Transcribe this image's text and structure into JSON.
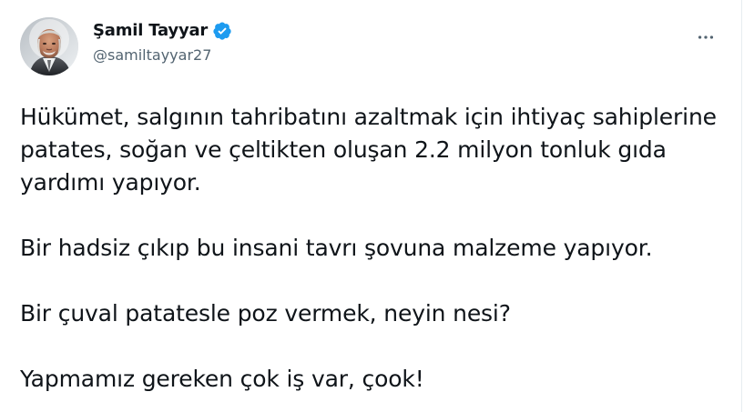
{
  "tweet": {
    "author": {
      "display_name": "Şamil Tayyar",
      "handle": "@samiltayyar27",
      "verified": true,
      "avatar_icon": "user-photo-avatar"
    },
    "more_label": "More",
    "paragraphs": [
      "Hükümet, salgının tahribatını azaltmak için ihtiyaç sahiplerine patates, soğan ve çeltikten oluşan 2.2 milyon tonluk gıda yardımı yapıyor.",
      "Bir hadsiz çıkıp bu insani tavrı şovuna malzeme yapıyor.",
      "Bir çuval patatesle poz vermek, neyin nesi?",
      "Yapmamız gereken çok iş var, çook!"
    ]
  },
  "colors": {
    "text_primary": "#0f1419",
    "text_secondary": "#536471",
    "verified_blue": "#1d9bf0",
    "divider": "#e6ecf0"
  },
  "icons": {
    "verified": "verified-badge-icon",
    "more": "more-horizontal-icon"
  }
}
